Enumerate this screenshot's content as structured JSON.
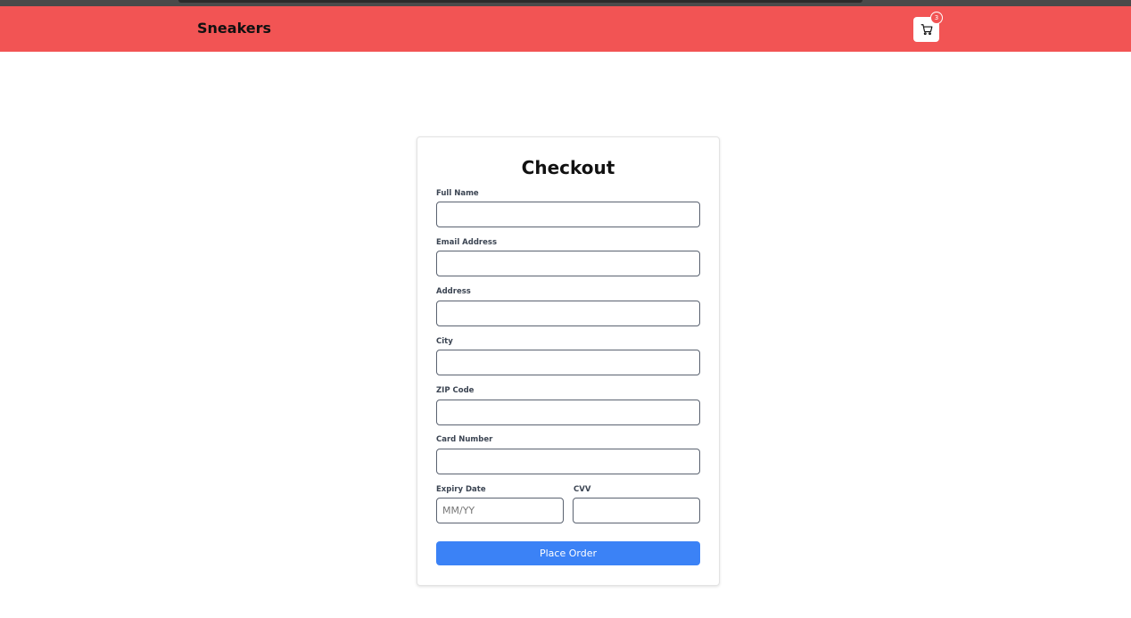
{
  "header": {
    "brand": "Sneakers",
    "cart_count": "3",
    "cart_icon": "shopping-cart-icon"
  },
  "checkout": {
    "title": "Checkout",
    "fields": {
      "full_name": {
        "label": "Full Name",
        "value": "",
        "placeholder": ""
      },
      "email": {
        "label": "Email Address",
        "value": "",
        "placeholder": ""
      },
      "address": {
        "label": "Address",
        "value": "",
        "placeholder": ""
      },
      "city": {
        "label": "City",
        "value": "",
        "placeholder": ""
      },
      "zip": {
        "label": "ZIP Code",
        "value": "",
        "placeholder": ""
      },
      "card_number": {
        "label": "Card Number",
        "value": "",
        "placeholder": ""
      },
      "expiry": {
        "label": "Expiry Date",
        "value": "",
        "placeholder": "MM/YY"
      },
      "cvv": {
        "label": "CVV",
        "value": "",
        "placeholder": ""
      }
    },
    "submit_label": "Place Order"
  },
  "colors": {
    "navbar": "#f25454",
    "primary_button": "#3b82f6"
  }
}
